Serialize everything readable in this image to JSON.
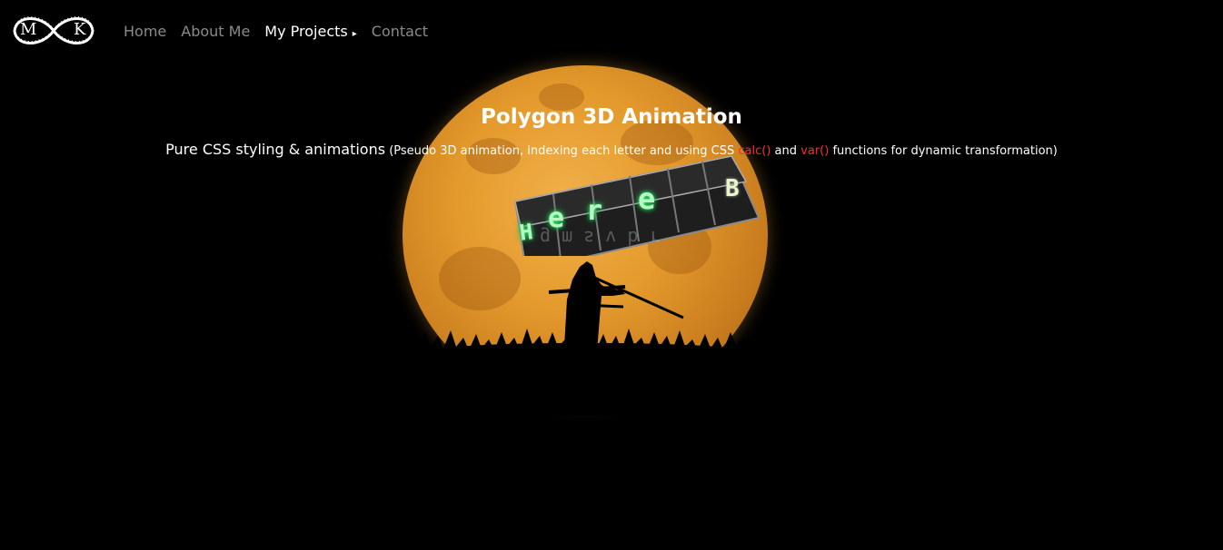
{
  "logo": {
    "letter_left": "M",
    "letter_right": "K"
  },
  "nav": {
    "items": [
      {
        "label": "Home"
      },
      {
        "label": "About Me"
      },
      {
        "label": "My Projects",
        "active": true
      },
      {
        "label": "Contact"
      }
    ],
    "caret": "▸"
  },
  "page": {
    "title": "Polygon 3D Animation",
    "subtitle_main": "Pure CSS styling & animations",
    "subtitle_paren_open": " (Pseudo 3D animation, indexing each letter and using CSS ",
    "code_calc": "calc()",
    "word_and": " and ",
    "code_var": "var()",
    "subtitle_end": " functions for dynamic transformation)"
  },
  "animation_letters": {
    "front": [
      "H",
      "e",
      "r",
      "e",
      "B"
    ],
    "back_mirrored": "g m s v  b r"
  },
  "colors": {
    "background": "#000000",
    "nav_inactive": "#8a8a8a",
    "nav_active": "#ffffff",
    "code_highlight": "#ff2a2a",
    "moon": "#e49a2c",
    "glyph_glow": "#2cff6a"
  }
}
